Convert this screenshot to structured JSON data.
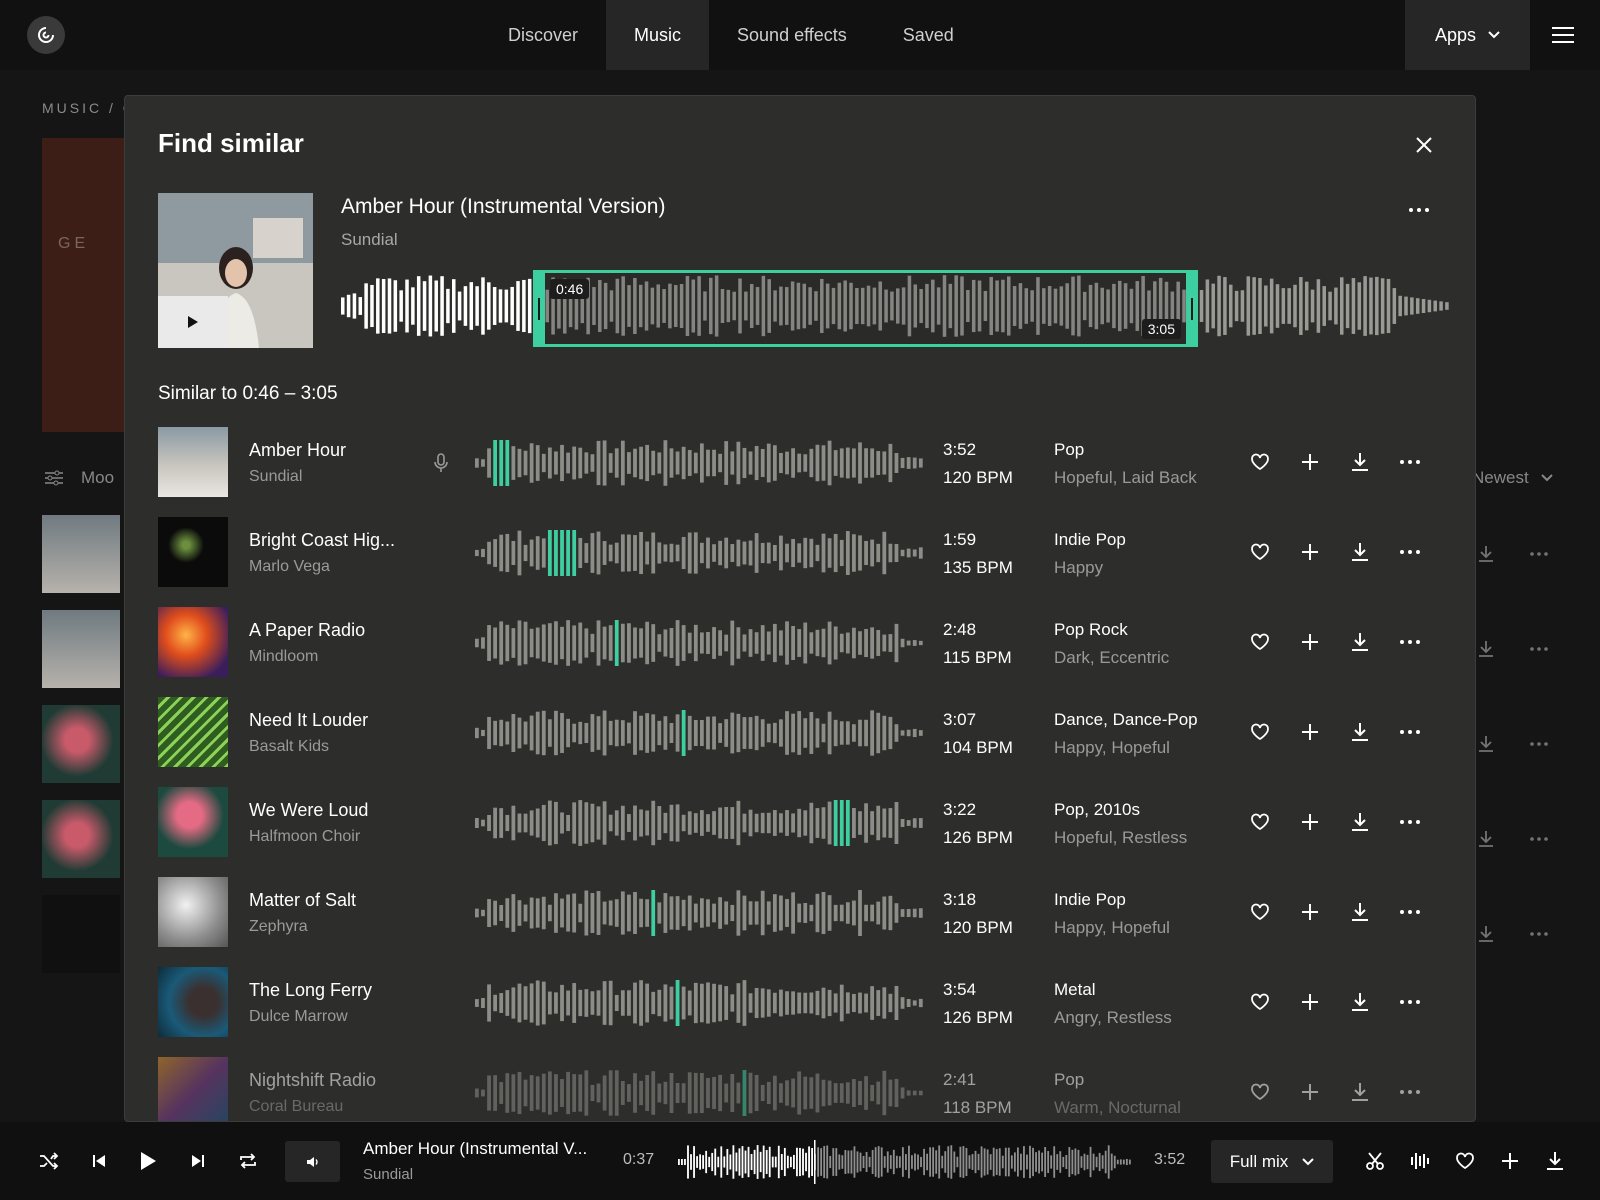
{
  "nav": {
    "tabs": [
      "Discover",
      "Music",
      "Sound effects",
      "Saved"
    ],
    "active_tab": "Music",
    "apps_label": "Apps"
  },
  "background": {
    "breadcrumb": "MUSIC / C",
    "hero_text": "GE",
    "filter_label": "Moo",
    "sort_label": "Newest"
  },
  "modal": {
    "title": "Find similar",
    "source": {
      "title": "Amber Hour (Instrumental Version)",
      "artist": "Sundial",
      "selection_start": "0:46",
      "selection_end": "3:05"
    },
    "similar_heading": "Similar to 0:46 – 3:05",
    "tracks": [
      {
        "title": "Amber Hour",
        "artist": "Sundial",
        "duration": "3:52",
        "bpm": "120 BPM",
        "genre": "Pop",
        "mood": "Hopeful, Laid Back",
        "has_vocals_icon": true,
        "match_position": 0.05
      },
      {
        "title": "Bright Coast Hig...",
        "artist": "Marlo Vega",
        "duration": "1:59",
        "bpm": "135 BPM",
        "genre": "Indie Pop",
        "mood": "Happy",
        "match_position": 0.19
      },
      {
        "title": "A Paper Radio",
        "artist": "Mindloom",
        "duration": "2:48",
        "bpm": "115 BPM",
        "genre": "Pop Rock",
        "mood": "Dark, Eccentric",
        "match_position": 0.31
      },
      {
        "title": "Need It Louder",
        "artist": "Basalt Kids",
        "duration": "3:07",
        "bpm": "104 BPM",
        "genre": "Dance, Dance-Pop",
        "mood": "Happy, Hopeful",
        "match_position": 0.47
      },
      {
        "title": "We Were Loud",
        "artist": "Halfmoon Choir",
        "duration": "3:22",
        "bpm": "126 BPM",
        "genre": "Pop, 2010s",
        "mood": "Hopeful, Restless",
        "match_position": 0.82
      },
      {
        "title": "Matter of Salt",
        "artist": "Zephyra",
        "duration": "3:18",
        "bpm": "120 BPM",
        "genre": "Indie Pop",
        "mood": "Happy, Hopeful",
        "match_position": 0.4
      },
      {
        "title": "The Long Ferry",
        "artist": "Dulce Marrow",
        "duration": "3:54",
        "bpm": "126 BPM",
        "genre": "Metal",
        "mood": "Angry, Restless",
        "match_position": 0.45
      },
      {
        "title": "Nightshift Radio",
        "artist": "Coral Bureau",
        "duration": "2:41",
        "bpm": "118 BPM",
        "genre": "Pop",
        "mood": "Warm, Nocturnal",
        "match_position": 0.6
      }
    ]
  },
  "player": {
    "title": "Amber Hour (Instrumental V...",
    "artist": "Sundial",
    "current_time": "0:37",
    "total_time": "3:52",
    "mix_label": "Full mix"
  },
  "colors": {
    "accent": "#3ecfa0",
    "wave": "#8d8d88",
    "surface": "#2d2d2c"
  }
}
